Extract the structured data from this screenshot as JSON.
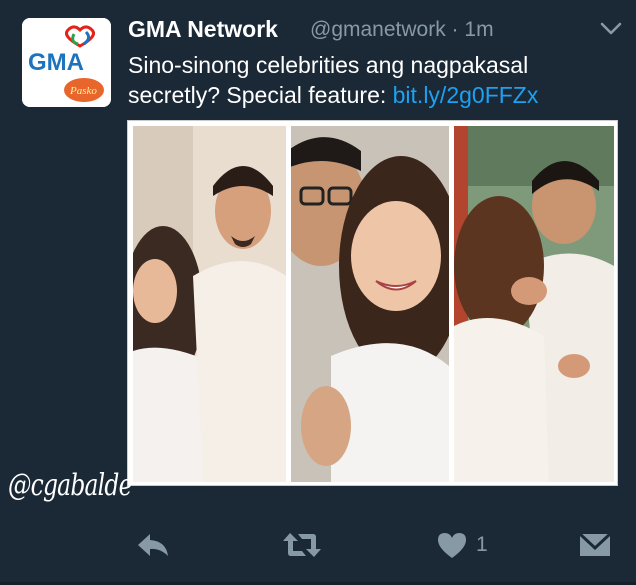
{
  "tweet": {
    "author_name": "GMA Network",
    "author_handle": "@gmanetwork",
    "separator": "·",
    "time": "1m",
    "text": "Sino-sinong celebrities ang nagpakasal secretly? Special feature: ",
    "link_text": "bit.ly/2g0FFZx"
  },
  "avatar": {
    "logo_text": "GMA",
    "sub_text": "Pasko"
  },
  "media": {
    "panels": [
      "couple-photo-1",
      "couple-photo-2",
      "couple-photo-3"
    ]
  },
  "watermark": "@cgabalde",
  "actions": {
    "reply_icon": "reply-icon",
    "retweet_icon": "retweet-icon",
    "like_icon": "heart-icon",
    "like_count": "1",
    "dm_icon": "envelope-icon"
  },
  "colors": {
    "background": "#1b2836",
    "link": "#1da1f2",
    "muted": "#8899a6",
    "text": "#ffffff"
  }
}
